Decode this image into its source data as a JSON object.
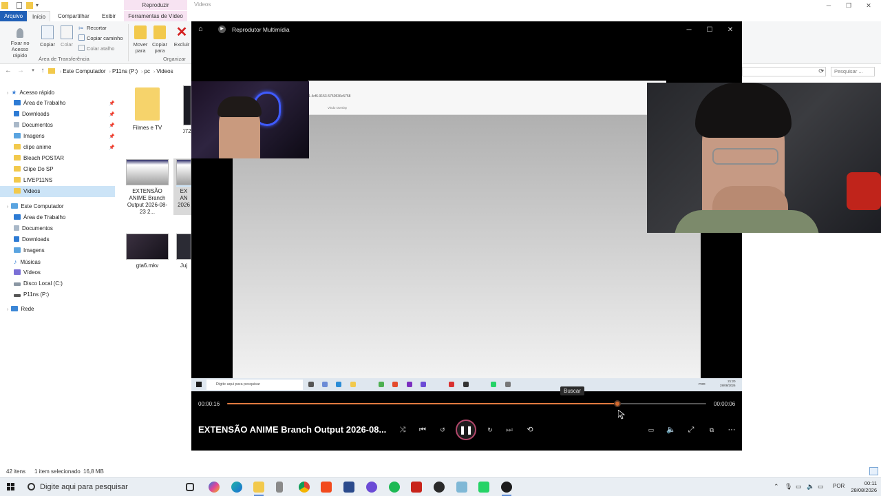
{
  "explorer": {
    "title": "Videos",
    "ribbon_tabs": {
      "arquivo": "Arquivo",
      "inicio": "Início",
      "compartilhar": "Compartilhar",
      "exibir": "Exibir",
      "reproduzir": "Reproduzir",
      "ferramentas": "Ferramentas de Vídeo"
    },
    "ribbon": {
      "fixar": "Fixar no Acesso rápido",
      "copiar": "Copiar",
      "colar": "Colar",
      "recortar": "Recortar",
      "copiar_caminho": "Copiar caminho",
      "colar_atalho": "Colar atalho",
      "mover_para": "Mover para",
      "copiar_para": "Copiar para",
      "excluir": "Excluir",
      "group_transferencia": "Área de Transferência",
      "group_organizar": "Organizar"
    },
    "breadcrumbs": [
      "Este Computador",
      "P11ns (P:)",
      "pc",
      "Videos"
    ],
    "search_placeholder": "Pesquisar ...",
    "nav": {
      "quick_access": "Acesso rápido",
      "quick_items": [
        "Área de Trabalho",
        "Downloads",
        "Documentos",
        "Imagens",
        "clipe anime",
        "Bleach POSTAR",
        "Clipe Do SP",
        "LIVEP11NS",
        "Videos"
      ],
      "este_computador": "Este Computador",
      "pc_items": [
        "Área de Trabalho",
        "Documentos",
        "Downloads",
        "Imagens",
        "Músicas",
        "Vídeos",
        "Disco Local (C:)",
        "P11ns (P:)"
      ],
      "rede": "Rede"
    },
    "files": [
      {
        "name": "Filmes e TV"
      },
      {
        "name": "072"
      },
      {
        "name": "EXTENSÃO ANIME Branch Output 2026-08-23 2..."
      },
      {
        "name": "EX AN 2026"
      },
      {
        "name": "gta6.mkv"
      },
      {
        "name": "Juj"
      }
    ],
    "status": {
      "count": "42 itens",
      "selection": "1 item selecionado",
      "size": "16,8 MB"
    }
  },
  "player": {
    "title": "Reprodutor Multimídia",
    "video": {
      "url_text": "1-4cf6-9153-5750536c5758",
      "overlay_text": "Vindo Overlay",
      "taskbar_search": "Digite aqui para pesquisar",
      "time": "21:20",
      "date": "28/08/2026",
      "lang": "POR"
    },
    "tooltip": "Buscar",
    "time_current": "00:00:16",
    "time_total": "00:00:06",
    "progress": 0.815,
    "now_playing": "EXTENSÃO ANIME Branch Output 2026-08..."
  },
  "taskbar": {
    "search_placeholder": "Digite aqui para pesquisar",
    "lang": "POR",
    "time": "00:11",
    "date": "28/08/2026"
  },
  "colors": {
    "accent_orange": "#e27a3f",
    "ribbon_pink": "#f7e3f2",
    "arquivo_blue": "#1f5fb7",
    "selection_blue": "#cce4f7"
  }
}
